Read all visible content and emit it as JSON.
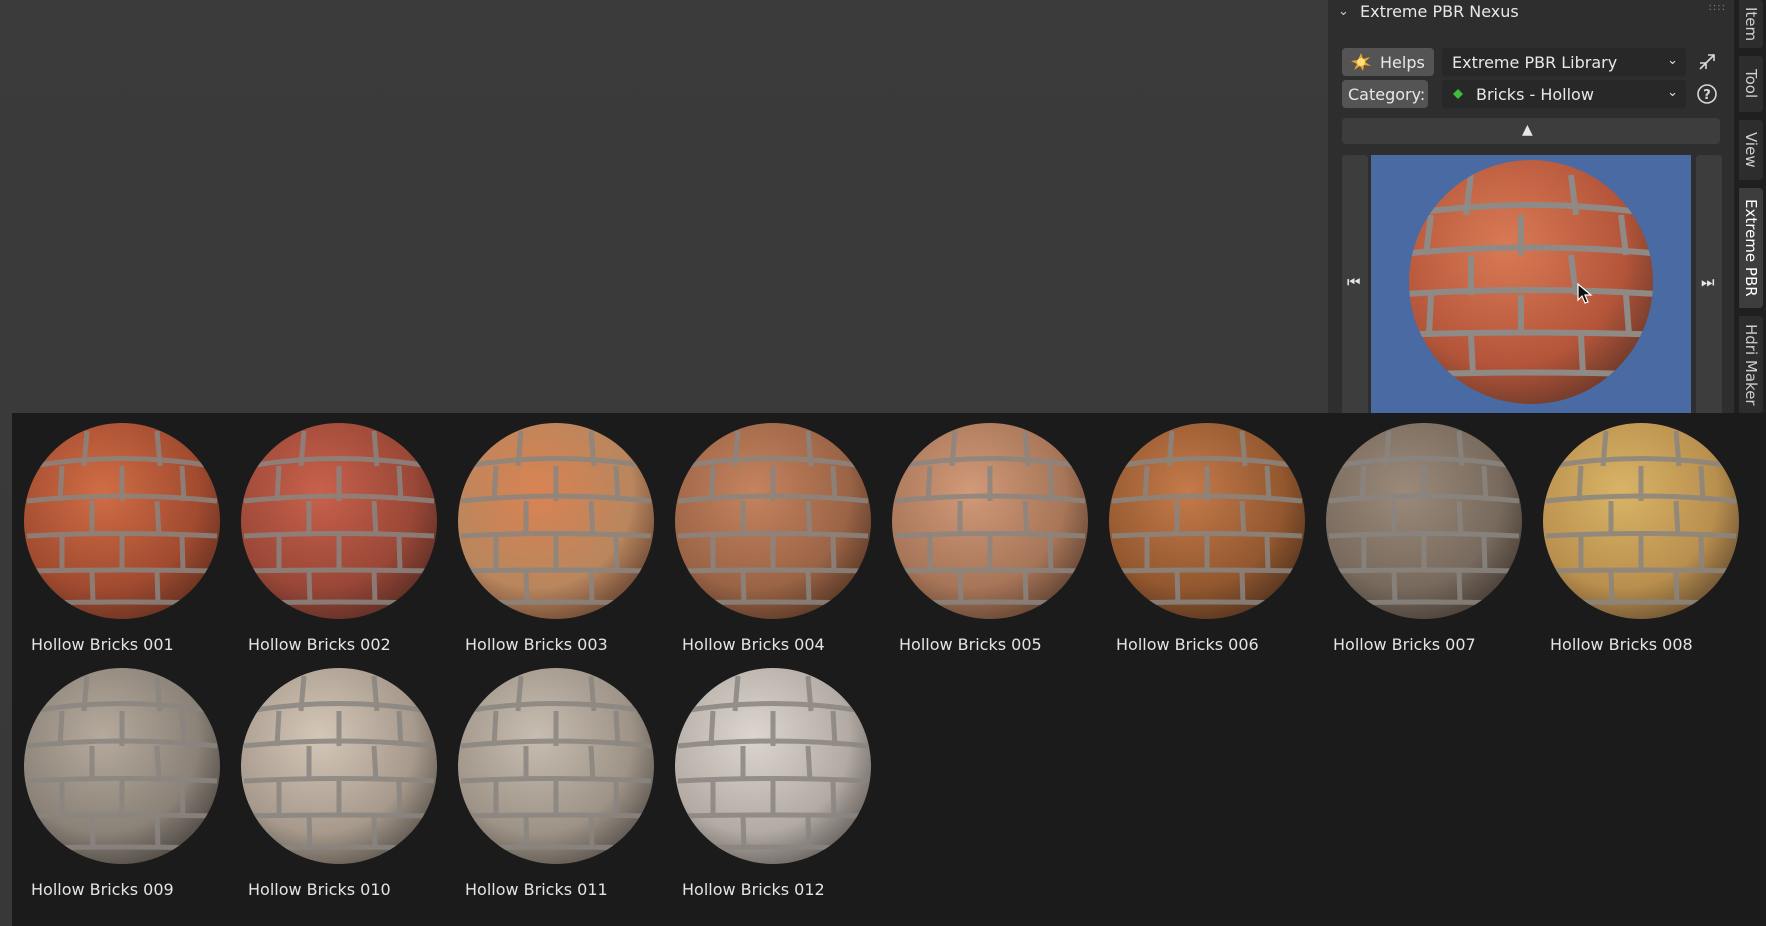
{
  "panel": {
    "title": "Extreme PBR Nexus",
    "helps_label": "Helps",
    "library": "Extreme PBR Library",
    "category_label": "Category:",
    "category_value": "Bricks - Hollow"
  },
  "tabs": [
    "Item",
    "Tool",
    "View",
    "Extreme PBR",
    "Hdri Maker"
  ],
  "active_tab": "Extreme PBR",
  "icons": {
    "collapse": "collapse-up-icon",
    "prev": "skip-previous-icon",
    "next": "skip-next-icon",
    "help": "help-icon",
    "shrink": "shrink-icon",
    "cursor": "mouse-cursor-icon"
  },
  "gallery": {
    "items": [
      "Hollow Bricks 001",
      "Hollow Bricks 002",
      "Hollow Bricks 003",
      "Hollow Bricks 004",
      "Hollow Bricks 005",
      "Hollow Bricks 006",
      "Hollow Bricks 007",
      "Hollow Bricks 008",
      "Hollow Bricks 009",
      "Hollow Bricks 010",
      "Hollow Bricks 011",
      "Hollow Bricks 012"
    ]
  },
  "colors": {
    "preview_bg": "#4a6aa3",
    "category_diamond": "#3bbf3b",
    "gallery_bg": "#1b1b1b"
  }
}
